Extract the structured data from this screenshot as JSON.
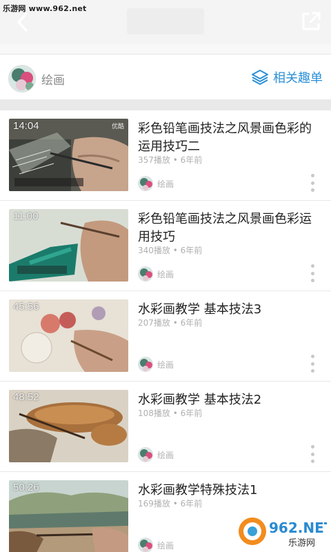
{
  "watermark_top": "乐游网 www.962.net",
  "header": {
    "back_icon": "back-arrow-icon",
    "share_icon": "share-external-icon"
  },
  "channel": {
    "name": "绘画",
    "related_label": "相关趣单",
    "related_icon": "layers-icon",
    "accent": "#2b8fd6"
  },
  "videos": [
    {
      "duration": "14:04",
      "title": "彩色铅笔画技法之风景画色彩的运用技巧二",
      "meta": "357播放 • 6年前",
      "author": "绘画",
      "thumb_tag": "优酷"
    },
    {
      "duration": "11:00",
      "title": "彩色铅笔画技法之风景画色彩运用技巧",
      "meta": "340播放 • 6年前",
      "author": "绘画",
      "thumb_tag": ""
    },
    {
      "duration": "45:56",
      "title": "水彩画教学 基本技法3",
      "meta": "207播放 • 6年前",
      "author": "绘画",
      "thumb_tag": ""
    },
    {
      "duration": "48:52",
      "title": "水彩画教学 基本技法2",
      "meta": "108播放 • 6年前",
      "author": "绘画",
      "thumb_tag": ""
    },
    {
      "duration": "50:26",
      "title": "水彩画教学特殊技法1",
      "meta": "169播放 • 6年前",
      "author": "绘画",
      "thumb_tag": ""
    }
  ],
  "watermark_logo": {
    "brand": "962.NET",
    "sub": "乐游网"
  }
}
